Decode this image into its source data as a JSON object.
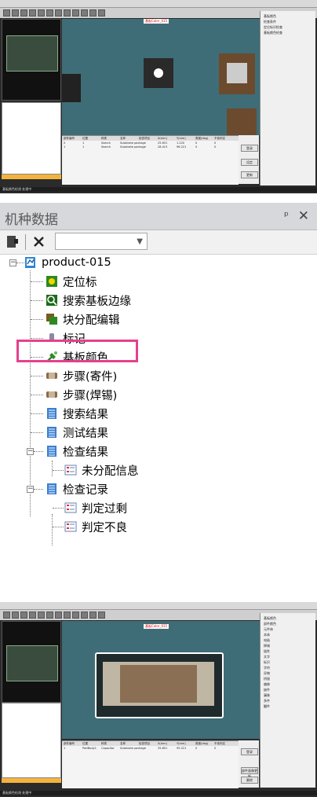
{
  "top_screen": {
    "view_tag": "基板Color_015",
    "results": {
      "headers": [
        "部件编号",
        "位置",
        "种类",
        "名称",
        "检查项目",
        "X(mm)",
        "Y(mm)",
        "角度(deg)",
        "不良判定"
      ],
      "rows": [
        [
          "0",
          "1",
          "Search",
          "Substrate package",
          "",
          "25.631",
          "1.220",
          "0",
          "0"
        ],
        [
          "1",
          "1",
          "Search",
          "Substrate package",
          "",
          "28.413",
          "96.221",
          "0",
          "0"
        ]
      ]
    },
    "side_items": [
      "基板颜色",
      "检查条件",
      "定位标识检查",
      "基板颜色检查"
    ],
    "buttons": [
      "登录",
      "设定",
      "更新",
      "追加",
      "删除"
    ],
    "status": "基板颜色检测 处理中"
  },
  "panel": {
    "title": "机种数据",
    "pin": "ᵖ",
    "close": "✕",
    "tree": {
      "root": "product-015",
      "items": [
        {
          "label": "定位标",
          "icon": "fiducial-icon"
        },
        {
          "label": "搜索基板边缘",
          "icon": "edge-search-icon"
        },
        {
          "label": "块分配编辑",
          "icon": "block-edit-icon"
        },
        {
          "label": "标记",
          "icon": "mark-icon"
        },
        {
          "label": "基板颜色",
          "icon": "board-color-icon"
        },
        {
          "label": "步骤(寄件)",
          "icon": "step-part-icon"
        },
        {
          "label": "步骤(焊锡)",
          "icon": "step-solder-icon"
        },
        {
          "label": "搜索结果",
          "icon": "search-result-icon"
        },
        {
          "label": "测试结果",
          "icon": "test-result-icon"
        },
        {
          "label": "检查结果",
          "icon": "inspect-result-icon"
        },
        {
          "label": "未分配信息",
          "icon": "unassigned-icon"
        },
        {
          "label": "检查记录",
          "icon": "inspect-log-icon"
        },
        {
          "label": "判定过剩",
          "icon": "judge-excess-icon"
        },
        {
          "label": "判定不良",
          "icon": "judge-defect-icon"
        }
      ]
    }
  },
  "bottom_screen": {
    "view_tag": "基板Color_015",
    "results": {
      "headers": [
        "部件编号",
        "位置",
        "种类",
        "名称",
        "检查项目",
        "X(mm)",
        "Y(mm)",
        "角度(deg)",
        "不良判定"
      ],
      "rows": [
        [
          "1",
          "PartBody1",
          "Capacitor",
          "Substrate package",
          "",
          "35.851",
          "95.221",
          "0",
          "0"
        ]
      ]
    },
    "side_items": [
      "基板颜色",
      "部件颜色",
      "元件体",
      "本体",
      "电极",
      "焊锡",
      "极性",
      "文字",
      "标识",
      "字符",
      "异物",
      "桥接",
      "偏移",
      "缺件",
      "漏装",
      "多件",
      "翻件"
    ],
    "buttons": [
      "登录",
      "部件画像更新",
      "删除"
    ],
    "status": "基板颜色检测 处理中"
  }
}
